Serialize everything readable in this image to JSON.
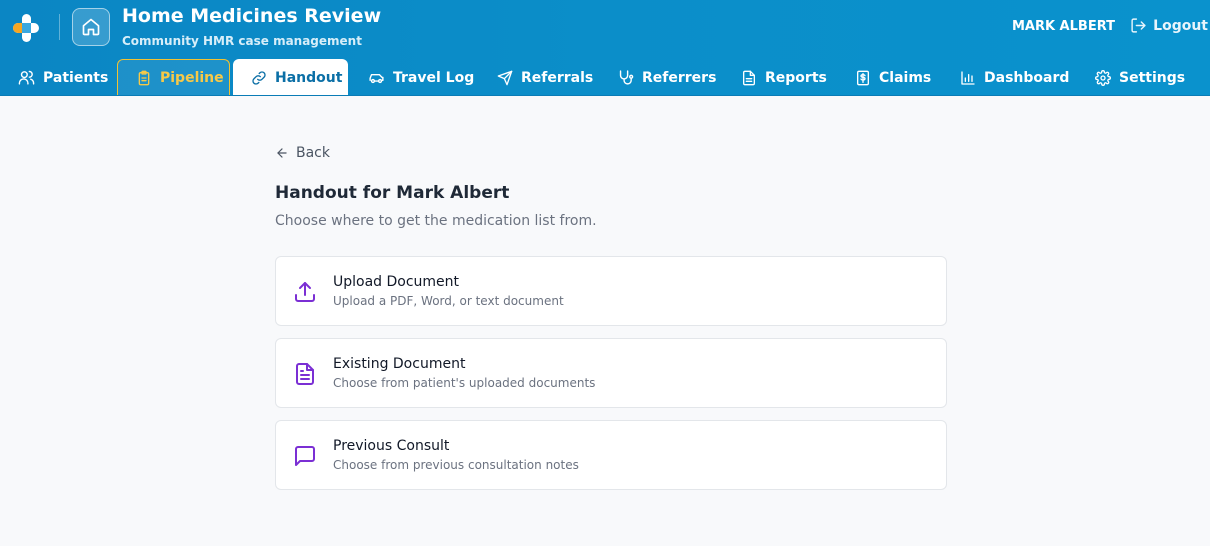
{
  "header": {
    "app_title": "Home Medicines Review",
    "app_subtitle": "Community HMR case management",
    "user_name": "MARK ALBERT",
    "logout_label": "Logout",
    "icons": {
      "logo": "app-logo-icon",
      "home": "home-icon",
      "logout": "logout-icon"
    }
  },
  "tabs": [
    {
      "label": "Patients",
      "icon": "users-icon"
    },
    {
      "label": "Pipeline",
      "icon": "clipboard-icon"
    },
    {
      "label": "Handout",
      "icon": "link-icon",
      "active": true
    },
    {
      "label": "Travel Log",
      "icon": "car-icon"
    },
    {
      "label": "Referrals",
      "icon": "send-icon"
    },
    {
      "label": "Referrers",
      "icon": "stethoscope-icon"
    },
    {
      "label": "Reports",
      "icon": "file-text-icon"
    },
    {
      "label": "Claims",
      "icon": "dollar-file-icon"
    },
    {
      "label": "Dashboard",
      "icon": "bar-chart-icon"
    },
    {
      "label": "Settings",
      "icon": "gear-icon"
    }
  ],
  "page": {
    "back_label": "Back",
    "title": "Handout for Mark Albert",
    "subtitle": "Choose where to get the medication list from.",
    "options": [
      {
        "title": "Upload Document",
        "description": "Upload a PDF, Word, or text document",
        "icon": "upload-icon"
      },
      {
        "title": "Existing Document",
        "description": "Choose from patient's uploaded documents",
        "icon": "document-icon"
      },
      {
        "title": "Previous Consult",
        "description": "Choose from previous consultation notes",
        "icon": "message-icon"
      }
    ]
  },
  "colors": {
    "header_bg": "#0b8ec9",
    "active_tab_text": "#0b6fa6",
    "pipeline_tab": "#f7c948",
    "option_icon": "#7b2fd4"
  }
}
